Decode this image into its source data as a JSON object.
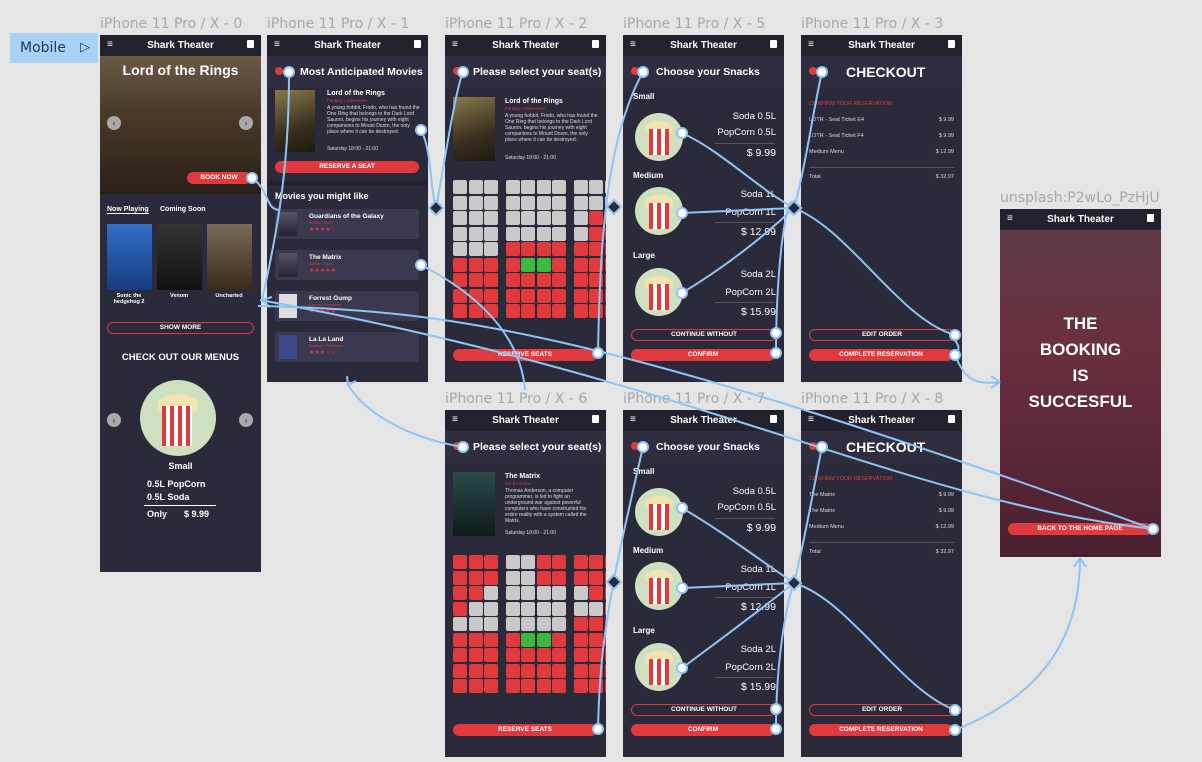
{
  "badge": {
    "label": "Mobile"
  },
  "frame_labels": {
    "x0": "iPhone 11 Pro / X - 0",
    "x1": "iPhone 11 Pro / X - 1",
    "x2": "iPhone 11 Pro / X - 2",
    "x5": "iPhone 11 Pro / X - 5",
    "x3": "iPhone 11 Pro / X - 3",
    "x6": "iPhone 11 Pro / X - 6",
    "x7": "iPhone 11 Pro / X - 7",
    "x8": "iPhone 11 Pro / X - 8",
    "uns": "unsplash:P2wLo_PzHjU"
  },
  "app_title": "Shark Theater",
  "x0": {
    "hero_title": "Lord of the Rings",
    "book_now": "BOOK NOW",
    "tabs": [
      "Now Playing",
      "Coming Soon"
    ],
    "movies": [
      "Sonic the hedgehog 2",
      "Venom",
      "Uncharted"
    ],
    "show_more": "SHOW MORE",
    "menus_title": "CHECK OUT OUR MENUS",
    "menu_size": "Small",
    "menu_items": [
      "0.5L PopCorn",
      "0.5L Soda"
    ],
    "only": "Only",
    "price": "$ 9.99"
  },
  "x1": {
    "header": "Most Anticipated Movies",
    "movie_title": "Lord of the Rings",
    "movie_genre": "Fantasy / Adventure",
    "movie_desc": "A young hobbit, Frodo, who has found the One Ring that belongs to the Dark Lord Sauron, begins his journey with eight companions to Mount Doom, the only place where it can be destroyed.",
    "time": "Saturday 18:00 - 21:00",
    "reserve": "RESERVE A SEAT",
    "like_header": "Movies you might like",
    "list": [
      {
        "title": "Guardians of the Galaxy",
        "genre": "Action / Sci-fi",
        "stars": "★★★★☆"
      },
      {
        "title": "The Matrix",
        "genre": "Action / Sci-fi",
        "stars": "★★★★★"
      },
      {
        "title": "Forrest Gump",
        "genre": "Drama / Romance",
        "stars": "★★★★★"
      },
      {
        "title": "La La Land",
        "genre": "Musical / Romance",
        "stars": "★★★☆☆"
      }
    ]
  },
  "x2": {
    "header": "Please select your seat(s)",
    "movie_title": "Lord of the Rings",
    "movie_genre": "Fantasy / Adventure",
    "movie_desc": "A young hobbit, Frodo, who has found the One Ring that belongs to the Dark Lord Sauron, begins his journey with eight companions to Mount Doom, the only place where it can be destroyed.",
    "time": "Saturday 18:00 - 21:00",
    "reserve": "RESERVE SEATS"
  },
  "x6": {
    "header": "Please select your seat(s)",
    "movie_title": "The Matrix",
    "movie_genre": "Sci-fi / Action",
    "movie_desc": "Thomas Anderson, a computer programmer, is led to fight an underground war against powerful computers who have constructed his entire reality with a system called the Matrix.",
    "time": "Saturday 18:00 - 21:00",
    "reserve": "RESERVE SEATS"
  },
  "snacks": {
    "header": "Choose your Snacks",
    "sizes": [
      {
        "label": "Small",
        "soda": "Soda 0.5L",
        "popcorn": "PopCorn 0.5L",
        "price": "$ 9.99"
      },
      {
        "label": "Medium",
        "soda": "Soda 1L",
        "popcorn": "PopCorn 1L",
        "price": "$ 12.99"
      },
      {
        "label": "Large",
        "soda": "Soda 2L",
        "popcorn": "PopCorn 2L",
        "price": "$ 15.99"
      }
    ],
    "continue": "CONTINUE WITHOUT",
    "confirm": "CONFIRM"
  },
  "x3": {
    "header": "CHECKOUT",
    "confirm_title": "CONFIRM YOUR RESERVATION",
    "rows": [
      {
        "label": "LOTR - Seat Ticket E4",
        "price": "$ 9.99"
      },
      {
        "label": "LOTR - Seat Ticket F4",
        "price": "$ 9.99"
      },
      {
        "label": "Medium Menu",
        "price": "$ 12.99"
      }
    ],
    "total_label": "Total",
    "total": "$ 32.97",
    "edit": "EDIT ORDER",
    "complete": "COMPLETE RESERVATION"
  },
  "x8": {
    "header": "CHECKOUT",
    "confirm_title": "CONFIRM YOUR RESERVATION",
    "rows": [
      {
        "label": "The Matrix",
        "price": "$ 9.99"
      },
      {
        "label": "The Matrix",
        "price": "$ 9.99"
      },
      {
        "label": "Medium Menu",
        "price": "$ 12.99"
      }
    ],
    "total_label": "Total",
    "total": "$ 32.97",
    "edit": "EDIT ORDER",
    "complete": "COMPLETE RESERVATION"
  },
  "success": {
    "lines": [
      "THE",
      "BOOKING",
      "IS",
      "SUCCESFUL"
    ],
    "back": "BACK TO THE HOME PAGE"
  },
  "colors": {
    "accent": "#e03a3e",
    "panel": "#2b2a3b",
    "wire": "#8ec5f5",
    "selected": "#3cba3c"
  }
}
